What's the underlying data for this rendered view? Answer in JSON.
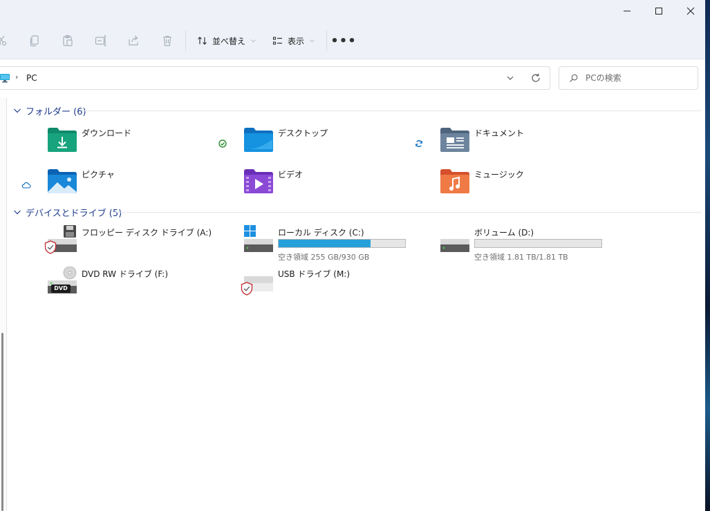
{
  "window_controls": {
    "minimize_icon": "minimize-icon",
    "maximize_icon": "maximize-icon",
    "close_icon": "close-icon"
  },
  "toolbar": {
    "sort_label": "並べ替え",
    "view_label": "表示",
    "more_label": "•••"
  },
  "address": {
    "path": "PC",
    "separator": "›"
  },
  "search": {
    "placeholder": "PCの検索"
  },
  "groups": {
    "folders": {
      "title": "フォルダー (6)"
    },
    "devices": {
      "title": "デバイスとドライブ (5)"
    }
  },
  "folders": [
    {
      "name": "ダウンロード",
      "icon": "download-folder-icon",
      "status": ""
    },
    {
      "name": "デスクトップ",
      "icon": "desktop-folder-icon",
      "status": "synced-check-icon"
    },
    {
      "name": "ドキュメント",
      "icon": "documents-folder-icon",
      "status": "syncing-icon"
    },
    {
      "name": "ピクチャ",
      "icon": "pictures-folder-icon",
      "status": "cloud-icon"
    },
    {
      "name": "ビデオ",
      "icon": "videos-folder-icon",
      "status": ""
    },
    {
      "name": "ミュージック",
      "icon": "music-folder-icon",
      "status": ""
    }
  ],
  "drives": [
    {
      "name": "フロッピー ディスク ドライブ (A:)",
      "icon": "floppy-drive-icon"
    },
    {
      "name": "ローカル ディスク (C:)",
      "icon": "windows-drive-icon",
      "used_fraction": 0.726,
      "free_text": "空き領域 255 GB/930 GB"
    },
    {
      "name": "ボリューム (D:)",
      "icon": "hard-drive-icon",
      "used_fraction": 0.0,
      "free_text": "空き領域 1.81 TB/1.81 TB"
    },
    {
      "name": "DVD RW ドライブ (F:)",
      "icon": "dvd-drive-icon",
      "badge": "DVD"
    },
    {
      "name": "USB ドライブ (M:)",
      "icon": "usb-drive-icon"
    }
  ],
  "colors": {
    "accent": "#26a0da",
    "group_header": "#1d3b8c",
    "sync_green": "#107c10",
    "sync_blue": "#0067c0"
  }
}
